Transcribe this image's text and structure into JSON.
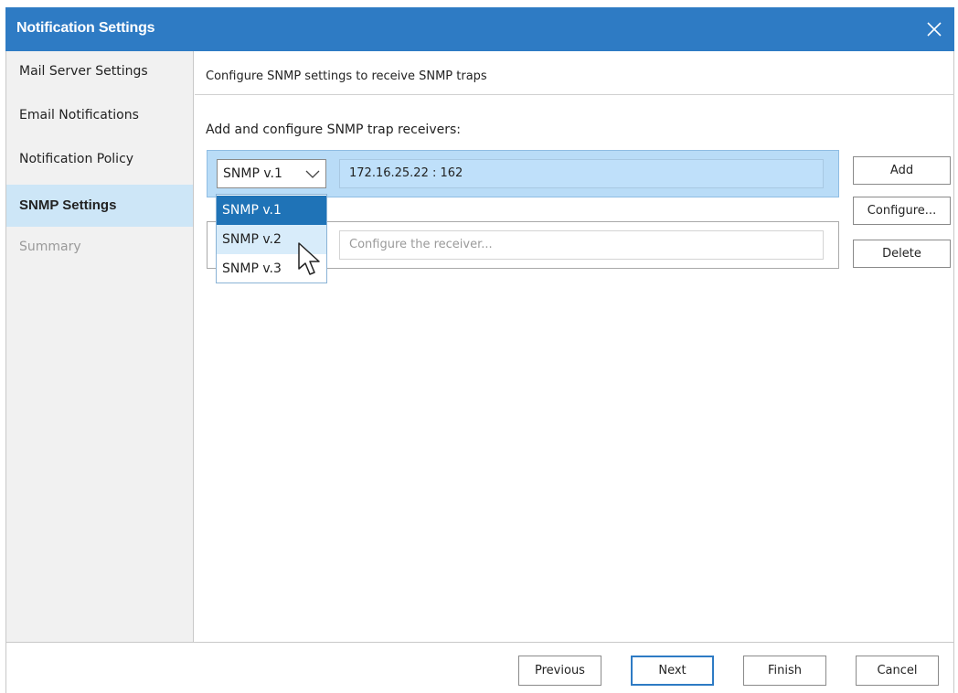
{
  "window": {
    "title": "Notification Settings"
  },
  "sidebar": {
    "items": [
      {
        "label": "Mail Server Settings"
      },
      {
        "label": "Email Notifications"
      },
      {
        "label": "Notification Policy"
      },
      {
        "label": "SNMP Settings"
      },
      {
        "label": "Summary"
      }
    ]
  },
  "main": {
    "heading": "Configure SNMP settings to receive SNMP traps",
    "section_label": "Add and configure SNMP trap receivers:",
    "receivers": [
      {
        "version": "SNMP v.1",
        "address": "172.16.25.22 : 162"
      },
      {
        "version": "",
        "address_placeholder": "Configure the receiver..."
      }
    ],
    "version_options": [
      "SNMP v.1",
      "SNMP v.2",
      "SNMP v.3"
    ],
    "buttons": {
      "add": "Add",
      "configure": "Configure...",
      "delete": "Delete"
    }
  },
  "footer": {
    "previous": "Previous",
    "next": "Next",
    "finish": "Finish",
    "cancel": "Cancel"
  },
  "colors": {
    "title_bar": "#2e7bc4",
    "sidebar_active": "#cde6f7",
    "row_selected": "#b9dcf7",
    "option_selected": "#1f73b7"
  }
}
